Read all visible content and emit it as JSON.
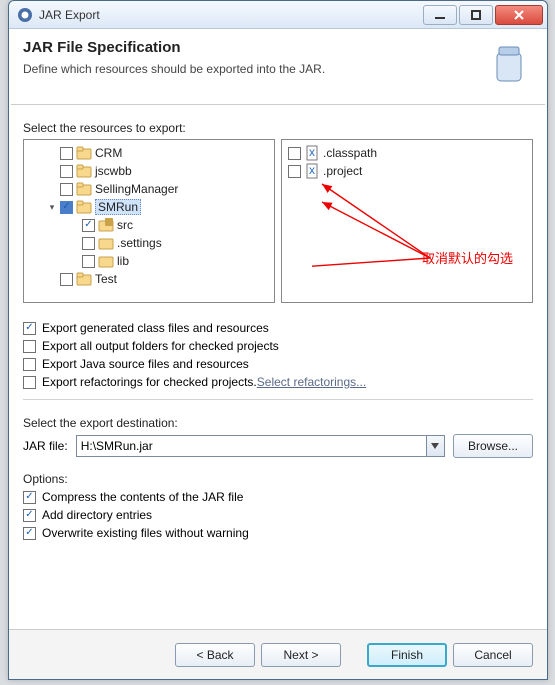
{
  "window": {
    "title": "JAR Export"
  },
  "header": {
    "title": "JAR File Specification",
    "subtitle": "Define which resources should be exported into the JAR."
  },
  "resources": {
    "label": "Select the resources to export:",
    "tree": [
      {
        "name": "CRM",
        "checked": false,
        "type": "project",
        "depth": 1
      },
      {
        "name": "jscwbb",
        "checked": false,
        "type": "project",
        "depth": 1
      },
      {
        "name": "SellingManager",
        "checked": false,
        "type": "project",
        "depth": 1
      },
      {
        "name": "SMRun",
        "checked": true,
        "type": "project",
        "depth": 1,
        "expanded": true,
        "children": [
          {
            "name": "src",
            "checked": true,
            "type": "src"
          },
          {
            "name": ".settings",
            "checked": false,
            "type": "folder"
          },
          {
            "name": "lib",
            "checked": false,
            "type": "folder"
          }
        ]
      },
      {
        "name": "Test",
        "checked": false,
        "type": "project",
        "depth": 1
      }
    ],
    "files": [
      {
        "name": ".classpath",
        "checked": false
      },
      {
        "name": ".project",
        "checked": false
      }
    ]
  },
  "exportOptions": [
    {
      "key": "genClass",
      "label": "Export generated class files and resources",
      "checked": true
    },
    {
      "key": "outFolders",
      "label": "Export all output folders for checked projects",
      "checked": false
    },
    {
      "key": "srcFiles",
      "label": "Export Java source files and resources",
      "checked": false
    },
    {
      "key": "refactor",
      "label": "Export refactorings for checked projects.",
      "checked": false,
      "link": "Select refactorings..."
    }
  ],
  "destination": {
    "label": "Select the export destination:",
    "fieldLabel": "JAR file:",
    "value": "H:\\SMRun.jar",
    "browse": "Browse..."
  },
  "options": {
    "label": "Options:",
    "items": [
      {
        "label": "Compress the contents of the JAR file",
        "checked": true
      },
      {
        "label": "Add directory entries",
        "checked": true
      },
      {
        "label": "Overwrite existing files without warning",
        "checked": true
      }
    ]
  },
  "footer": {
    "back": "< Back",
    "next": "Next >",
    "finish": "Finish",
    "cancel": "Cancel"
  },
  "annotation": {
    "text": "取消默认的勾选"
  }
}
